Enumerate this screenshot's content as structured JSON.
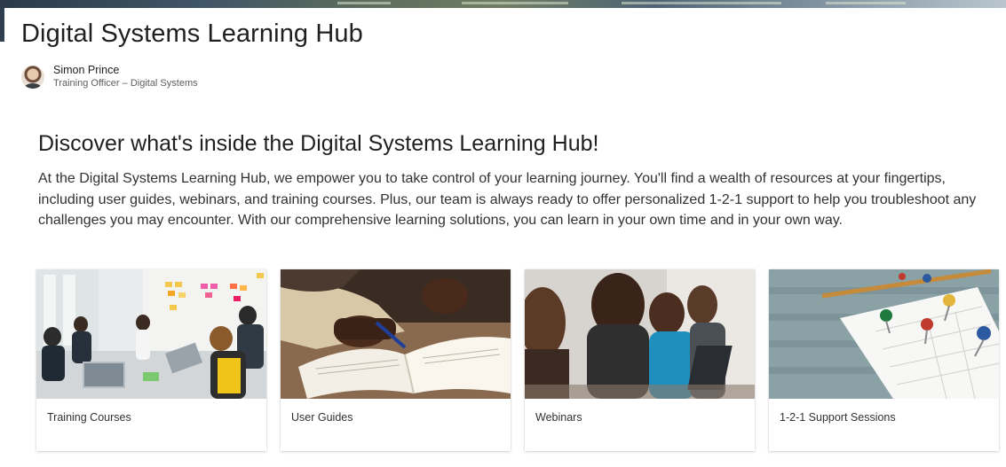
{
  "banner": {
    "accent": "#2f3f4f"
  },
  "page": {
    "title": "Digital Systems Learning Hub"
  },
  "author": {
    "name": "Simon Prince",
    "role": "Training Officer – Digital Systems"
  },
  "content": {
    "heading": "Discover what's inside the Digital Systems Learning Hub!",
    "intro": "At the Digital Systems Learning Hub, we empower you to take control of your learning journey. You'll find a wealth of resources at your fingertips, including user guides, webinars, and training courses. Plus, our team is always ready to offer personalized 1-2-1 support to help you troubleshoot any challenges you may encounter. With our comprehensive learning solutions, you can learn in your own time and in your own way."
  },
  "cards": [
    {
      "label": "Training Courses",
      "image": "office-meeting-photo"
    },
    {
      "label": "User Guides",
      "image": "book-writing-photo"
    },
    {
      "label": "Webinars",
      "image": "students-laptop-photo"
    },
    {
      "label": "1-2-1 Support Sessions",
      "image": "calendar-pins-photo"
    }
  ]
}
